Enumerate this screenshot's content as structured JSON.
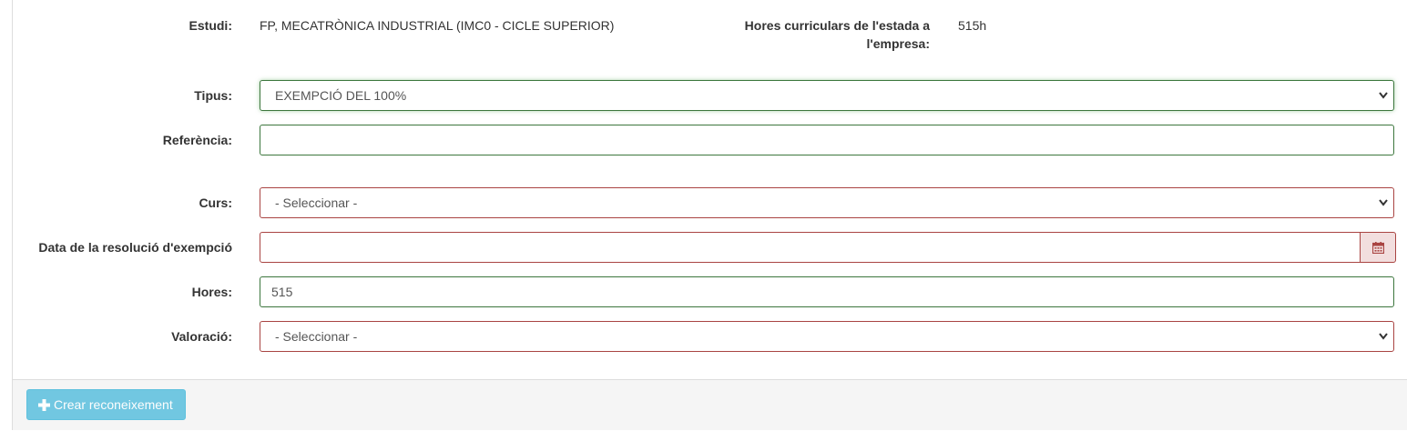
{
  "study": {
    "label": "Estudi:",
    "value": "FP, MECATRÒNICA INDUSTRIAL (IMC0 - CICLE SUPERIOR)"
  },
  "hours_curricular": {
    "label_line1": "Hores curriculars de l'estada a",
    "label_line2": "l'empresa:",
    "value": "515h"
  },
  "form": {
    "tipus": {
      "label": "Tipus:",
      "selected": "EXEMPCIÓ DEL 100%"
    },
    "referencia": {
      "label": "Referència:",
      "value": ""
    },
    "curs": {
      "label": "Curs:",
      "selected": "- Seleccionar -"
    },
    "data_resolucio": {
      "label": "Data de la resolució d'exempció",
      "value": ""
    },
    "hores": {
      "label": "Hores:",
      "value": "515"
    },
    "valoracio": {
      "label": "Valoració:",
      "selected": "- Seleccionar -"
    }
  },
  "actions": {
    "create_label": "Crear reconeixement"
  },
  "icons": {
    "calendar": "calendar-icon",
    "plus": "plus-icon",
    "chevron": "chevron-down-icon"
  },
  "colors": {
    "valid_border": "#3c763d",
    "error_border": "#a94442",
    "error_bg": "#f2dede",
    "button_bg": "#5bc0de"
  }
}
